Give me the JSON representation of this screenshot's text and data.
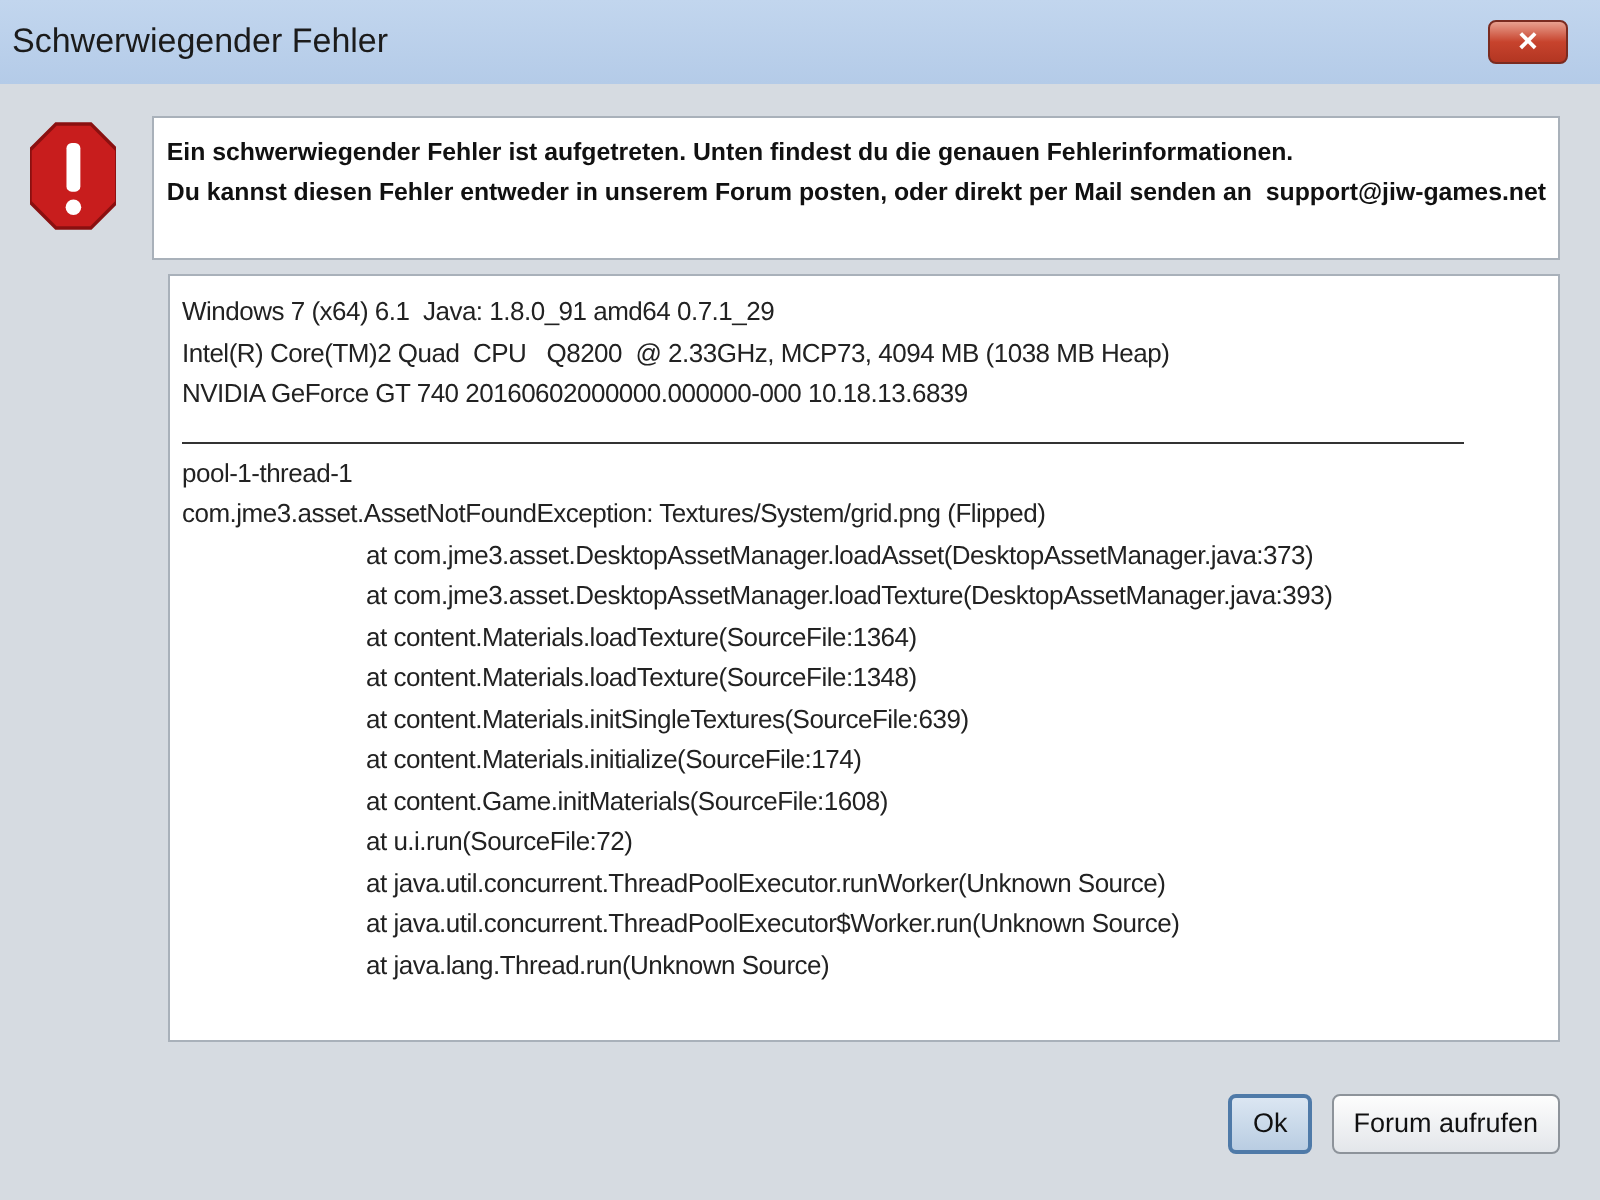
{
  "window": {
    "title": "Schwerwiegender Fehler",
    "close": "×"
  },
  "message": {
    "lines": [
      "Ein schwerwiegender Fehler ist aufgetreten. Unten findest du die genauen Fehlerinformationen.",
      "Du kannst diesen Fehler entweder in unserem Forum posten, oder direkt per Mail senden an  support@jiw-games.net"
    ]
  },
  "details": {
    "system_info": [
      "Windows 7 (x64) 6.1  Java: 1.8.0_91 amd64 0.7.1_29",
      "Intel(R) Core(TM)2 Quad  CPU   Q8200  @ 2.33GHz, MCP73, 4094 MB (1038 MB Heap)",
      "NVIDIA GeForce GT 740 20160602000000.000000-000 10.18.13.6839"
    ],
    "thread": "pool-1-thread-1",
    "exception": "com.jme3.asset.AssetNotFoundException: Textures/System/grid.png (Flipped)",
    "frames": [
      "at com.jme3.asset.DesktopAssetManager.loadAsset(DesktopAssetManager.java:373)",
      "at com.jme3.asset.DesktopAssetManager.loadTexture(DesktopAssetManager.java:393)",
      "at content.Materials.loadTexture(SourceFile:1364)",
      "at content.Materials.loadTexture(SourceFile:1348)",
      "at content.Materials.initSingleTextures(SourceFile:639)",
      "at content.Materials.initialize(SourceFile:174)",
      "at content.Game.initMaterials(SourceFile:1608)",
      "at u.i.run(SourceFile:72)",
      "at java.util.concurrent.ThreadPoolExecutor.runWorker(Unknown Source)",
      "at java.util.concurrent.ThreadPoolExecutor$Worker.run(Unknown Source)",
      "at java.lang.Thread.run(Unknown Source)"
    ]
  },
  "buttons": [
    {
      "label": "Ok",
      "focused": true
    },
    {
      "label": "Forum aufrufen",
      "focused": false
    }
  ]
}
